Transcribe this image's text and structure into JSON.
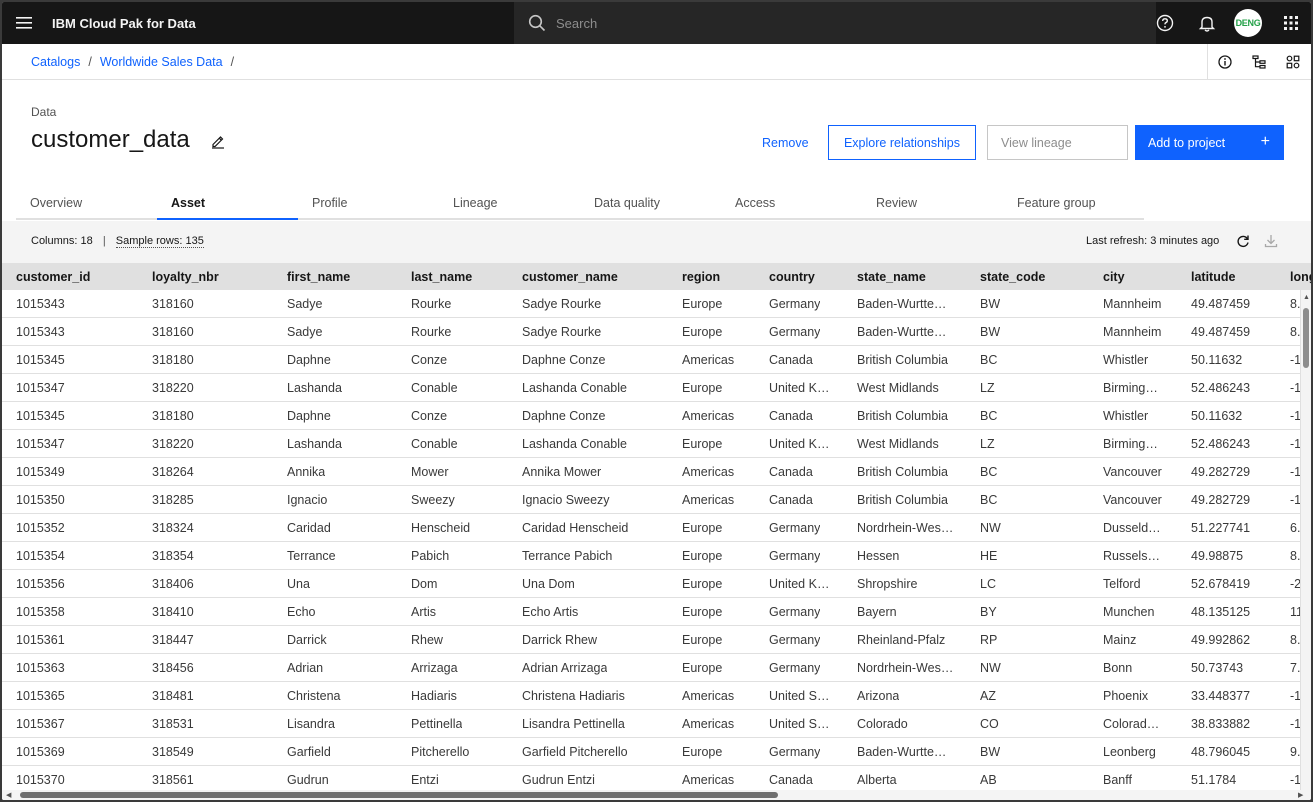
{
  "app": {
    "title": "IBM Cloud Pak for Data"
  },
  "search": {
    "placeholder": "Search"
  },
  "user": {
    "initials": "DENG"
  },
  "breadcrumb": {
    "items": [
      "Catalogs",
      "Worldwide Sales Data"
    ],
    "separator": "/"
  },
  "asset": {
    "kind": "Data",
    "name": "customer_data"
  },
  "actions": {
    "remove": "Remove",
    "explore": "Explore relationships",
    "lineage": "View lineage",
    "add": "Add to project",
    "add_icon": "+"
  },
  "tabs": [
    "Overview",
    "Asset",
    "Profile",
    "Lineage",
    "Data quality",
    "Access",
    "Review",
    "Feature group"
  ],
  "active_tab": "Asset",
  "toolbar": {
    "columns_label": "Columns:",
    "columns_value": "18",
    "pipe": "|",
    "sample_label": "Sample rows:",
    "sample_value": "135",
    "refresh": "Last refresh: 3 minutes ago"
  },
  "table": {
    "headers": [
      "customer_id",
      "loyalty_nbr",
      "first_name",
      "last_name",
      "customer_name",
      "region",
      "country",
      "state_name",
      "state_code",
      "city",
      "latitude",
      "long"
    ],
    "rows": [
      [
        "1015343",
        "318160",
        "Sadye",
        "Rourke",
        "Sadye Rourke",
        "Europe",
        "Germany",
        "Baden-Wurtte…",
        "BW",
        "Mannheim",
        "49.487459",
        "8."
      ],
      [
        "1015343",
        "318160",
        "Sadye",
        "Rourke",
        "Sadye Rourke",
        "Europe",
        "Germany",
        "Baden-Wurtte…",
        "BW",
        "Mannheim",
        "49.487459",
        "8."
      ],
      [
        "1015345",
        "318180",
        "Daphne",
        "Conze",
        "Daphne Conze",
        "Americas",
        "Canada",
        "British Columbia",
        "BC",
        "Whistler",
        "50.11632",
        "-1"
      ],
      [
        "1015347",
        "318220",
        "Lashanda",
        "Conable",
        "Lashanda Conable",
        "Europe",
        "United K…",
        "West Midlands",
        "LZ",
        "Birming…",
        "52.486243",
        "-1"
      ],
      [
        "1015345",
        "318180",
        "Daphne",
        "Conze",
        "Daphne Conze",
        "Americas",
        "Canada",
        "British Columbia",
        "BC",
        "Whistler",
        "50.11632",
        "-1"
      ],
      [
        "1015347",
        "318220",
        "Lashanda",
        "Conable",
        "Lashanda Conable",
        "Europe",
        "United K…",
        "West Midlands",
        "LZ",
        "Birming…",
        "52.486243",
        "-1"
      ],
      [
        "1015349",
        "318264",
        "Annika",
        "Mower",
        "Annika Mower",
        "Americas",
        "Canada",
        "British Columbia",
        "BC",
        "Vancouver",
        "49.282729",
        "-1"
      ],
      [
        "1015350",
        "318285",
        "Ignacio",
        "Sweezy",
        "Ignacio Sweezy",
        "Americas",
        "Canada",
        "British Columbia",
        "BC",
        "Vancouver",
        "49.282729",
        "-1"
      ],
      [
        "1015352",
        "318324",
        "Caridad",
        "Henscheid",
        "Caridad Henscheid",
        "Europe",
        "Germany",
        "Nordrhein-Wes…",
        "NW",
        "Dusseld…",
        "51.227741",
        "6."
      ],
      [
        "1015354",
        "318354",
        "Terrance",
        "Pabich",
        "Terrance Pabich",
        "Europe",
        "Germany",
        "Hessen",
        "HE",
        "Russels…",
        "49.98875",
        "8."
      ],
      [
        "1015356",
        "318406",
        "Una",
        "Dom",
        "Una Dom",
        "Europe",
        "United K…",
        "Shropshire",
        "LC",
        "Telford",
        "52.678419",
        "-2"
      ],
      [
        "1015358",
        "318410",
        "Echo",
        "Artis",
        "Echo Artis",
        "Europe",
        "Germany",
        "Bayern",
        "BY",
        "Munchen",
        "48.135125",
        "11"
      ],
      [
        "1015361",
        "318447",
        "Darrick",
        "Rhew",
        "Darrick Rhew",
        "Europe",
        "Germany",
        "Rheinland-Pfalz",
        "RP",
        "Mainz",
        "49.992862",
        "8."
      ],
      [
        "1015363",
        "318456",
        "Adrian",
        "Arrizaga",
        "Adrian Arrizaga",
        "Europe",
        "Germany",
        "Nordrhein-Wes…",
        "NW",
        "Bonn",
        "50.73743",
        "7."
      ],
      [
        "1015365",
        "318481",
        "Christena",
        "Hadiaris",
        "Christena Hadiaris",
        "Americas",
        "United S…",
        "Arizona",
        "AZ",
        "Phoenix",
        "33.448377",
        "-1"
      ],
      [
        "1015367",
        "318531",
        "Lisandra",
        "Pettinella",
        "Lisandra Pettinella",
        "Americas",
        "United S…",
        "Colorado",
        "CO",
        "Colorad…",
        "38.833882",
        "-1"
      ],
      [
        "1015369",
        "318549",
        "Garfield",
        "Pitcherello",
        "Garfield Pitcherello",
        "Europe",
        "Germany",
        "Baden-Wurtte…",
        "BW",
        "Leonberg",
        "48.796045",
        "9."
      ],
      [
        "1015370",
        "318561",
        "Gudrun",
        "Entzi",
        "Gudrun Entzi",
        "Americas",
        "Canada",
        "Alberta",
        "AB",
        "Banff",
        "51.1784",
        "-1"
      ]
    ]
  },
  "icons": {
    "menu": "hamburger-menu-icon",
    "search": "search-icon",
    "help": "help-icon",
    "notification": "notification-icon",
    "switcher": "app-switcher-icon",
    "info": "info-icon",
    "tree": "tree-view-icon",
    "settings": "data-settings-icon",
    "edit": "edit-icon",
    "refresh": "refresh-icon",
    "download": "download-icon"
  },
  "colors": {
    "accent": "#0f62fe",
    "header_bg": "#161616",
    "avatar_text": "#24a148"
  }
}
